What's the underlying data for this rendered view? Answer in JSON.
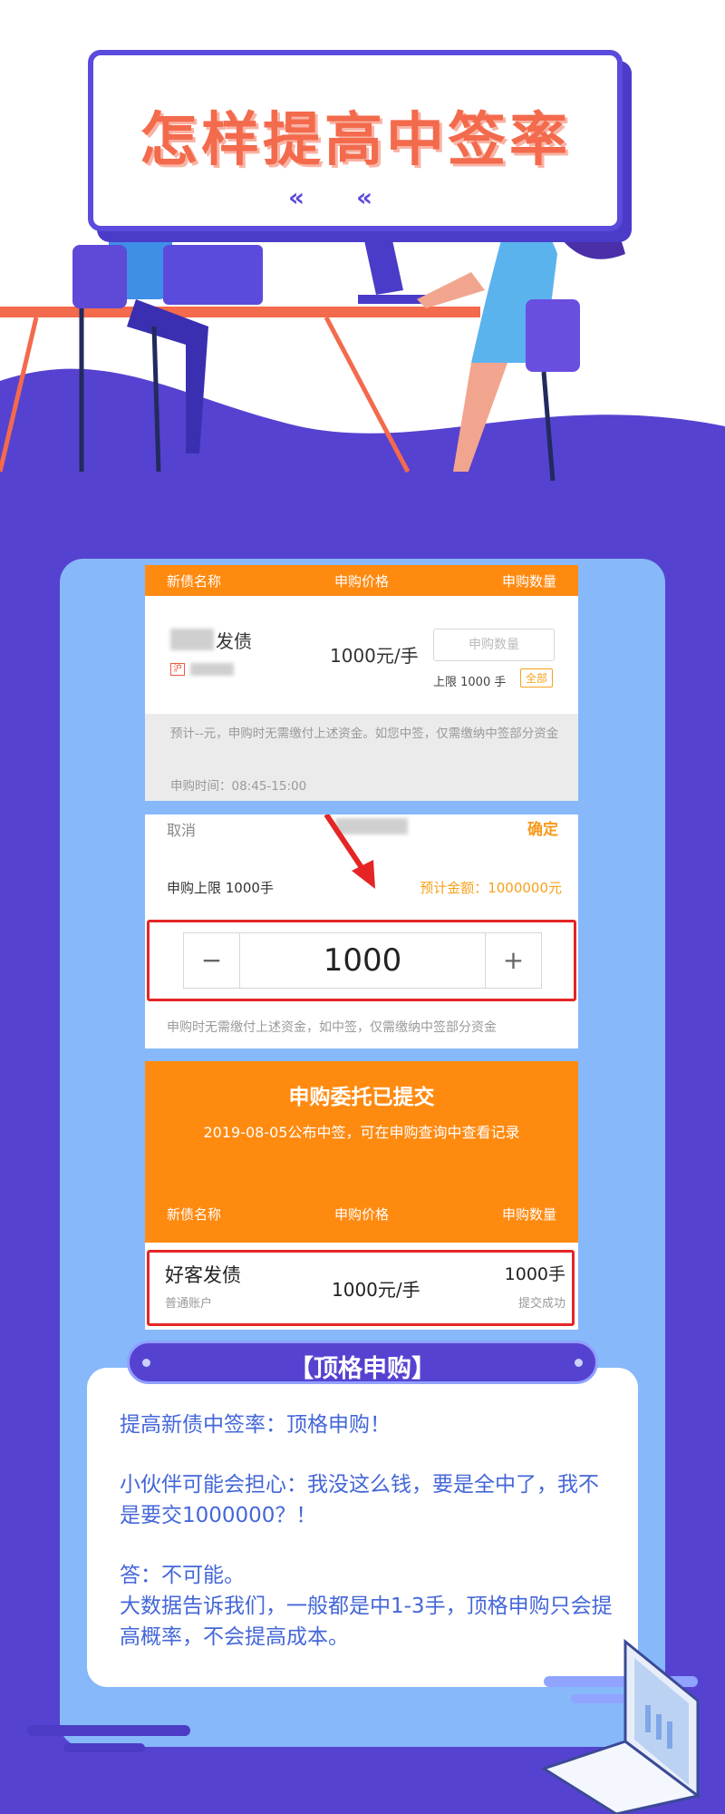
{
  "title": "怎样提高中签率",
  "screenshot1": {
    "col_name": "新债名称",
    "col_price": "申购价格",
    "col_qty": "申购数量",
    "bond_name": "发债",
    "tag": "沪",
    "price": "1000元/手",
    "input_placeholder": "申购数量",
    "limit": "上限 1000 手",
    "all_button": "全部",
    "note": "预计--元，申购时无需缴付上述资金。如您中签，仅需缴纳中签部分资金",
    "time": "申购时间：08:45-15:00"
  },
  "screenshot2": {
    "cancel": "取消",
    "confirm": "确定",
    "limit": "申购上限 1000手",
    "estimate": "预计金额：1000000元",
    "minus": "−",
    "plus": "+",
    "value": "1000",
    "note": "申购时无需缴付上述资金，如中签，仅需缴纳中签部分资金"
  },
  "screenshot3": {
    "title": "申购委托已提交",
    "subtitle": "2019-08-05公布中签，可在申购查询中查看记录",
    "col_name": "新债名称",
    "col_price": "申购价格",
    "col_qty": "申购数量",
    "bond_name": "好客发债",
    "account": "普通账户",
    "price": "1000元/手",
    "qty": "1000手",
    "status": "提交成功"
  },
  "ribbon": {
    "label": "【顶格申购】"
  },
  "panel": {
    "line1": "提高新债中签率：顶格申购！",
    "line2": "小伙伴可能会担心：我没这么钱，要是全中了，我不是要交1000000？！",
    "line3": "答：不可能。",
    "line4": "大数据告诉我们，一般都是中1-3手，顶格申购只会提高概率，不会提高成本。"
  },
  "colors": {
    "purple": "#5642d0",
    "light_blue": "#86b8fa",
    "orange": "#ff8a10",
    "title_coral": "#f36a4c",
    "text_blue": "#4467d8",
    "highlight_red": "#e52525"
  }
}
